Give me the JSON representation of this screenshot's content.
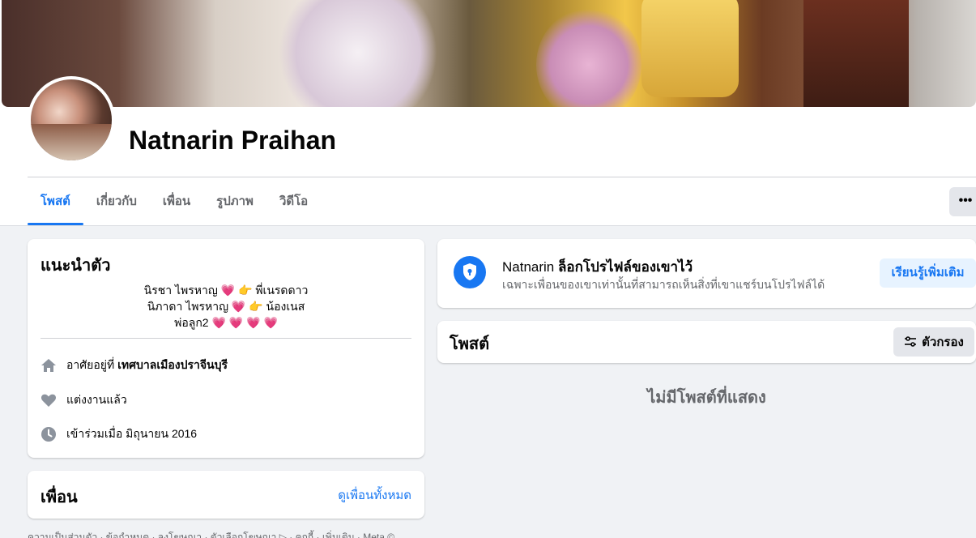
{
  "profile": {
    "name": "Natnarin Praihan"
  },
  "tabs": [
    {
      "label": "โพสต์",
      "active": true
    },
    {
      "label": "เกี่ยวกับ",
      "active": false
    },
    {
      "label": "เพื่อน",
      "active": false
    },
    {
      "label": "รูปภาพ",
      "active": false
    },
    {
      "label": "วิดีโอ",
      "active": false
    }
  ],
  "more_label": "•••",
  "intro": {
    "title": "แนะนำตัว",
    "bio_lines": [
      "นิรชา ไพรหาญ 💗 👉 พี่เนรดดาว",
      "นิภาดา ไพรหาญ 💗 👉 น้องเนส",
      "พ่อลูก2 💗 💗 💗 💗"
    ],
    "lives_prefix": "อาศัยอยู่ที่",
    "lives_place": "เทศบาลเมืองปราจีนบุรี",
    "relationship": "แต่งงานแล้ว",
    "joined": "เข้าร่วมเมื่อ มิถุนายน 2016"
  },
  "friends": {
    "title": "เพื่อน",
    "see_all": "ดูเพื่อนทั้งหมด"
  },
  "footer": "ความเป็นส่วนตัว · ข้อกำหนด · ลงโฆษณา · ตัวเลือกโฆษณา ▷ · คุกกี้ · เพิ่มเติม · Meta ©",
  "locked": {
    "name": "Natnarin",
    "title_rest": "ล็อกโปรไฟล์ของเขาไว้",
    "subtitle": "เฉพาะเพื่อนของเขาเท่านั้นที่สามารถเห็นสิ่งที่เขาแชร์บนโปรไฟล์ได้",
    "learn_more": "เรียนรู้เพิ่มเติม"
  },
  "posts": {
    "title": "โพสต์",
    "filter_label": "ตัวกรอง",
    "empty_text": "ไม่มีโพสต์ที่แสดง"
  },
  "colors": {
    "accent": "#1877f2",
    "background": "#f0f2f5",
    "secondary_text": "#65676b"
  }
}
